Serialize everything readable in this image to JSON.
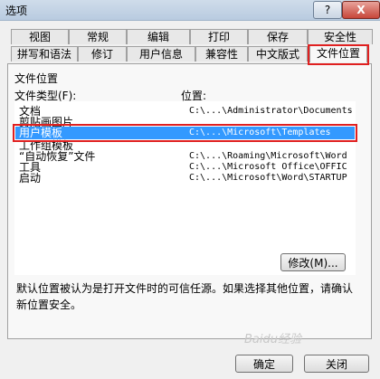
{
  "window": {
    "title": "选项",
    "help": "?",
    "close": "X"
  },
  "tabs_row1": [
    "视图",
    "常规",
    "编辑",
    "打印",
    "保存",
    "安全性"
  ],
  "tabs_row2": [
    "拼写和语法",
    "修订",
    "用户信息",
    "兼容性",
    "中文版式",
    "文件位置"
  ],
  "panel": {
    "group_title": "文件位置",
    "col_type": "文件类型(F):",
    "col_location": "位置:"
  },
  "list": [
    {
      "type": "文档",
      "path": "C:\\...\\Administrator\\Documents"
    },
    {
      "type": "剪贴画图片",
      "path": ""
    },
    {
      "type": "用户模板",
      "path": "C:\\...\\Microsoft\\Templates"
    },
    {
      "type": "工作组模板",
      "path": ""
    },
    {
      "type": "“自动恢复”文件",
      "path": "C:\\...\\Roaming\\Microsoft\\Word"
    },
    {
      "type": "工具",
      "path": "C:\\...\\Microsoft Office\\OFFIC"
    },
    {
      "type": "启动",
      "path": "C:\\...\\Microsoft\\Word\\STARTUP"
    }
  ],
  "buttons": {
    "modify": "修改(M)...",
    "ok": "确定",
    "close": "关闭"
  },
  "note": "默认位置被认为是打开文件时的可信任源。如果选择其他位置，请确认新位置安全。",
  "watermark": "Baidu经验"
}
